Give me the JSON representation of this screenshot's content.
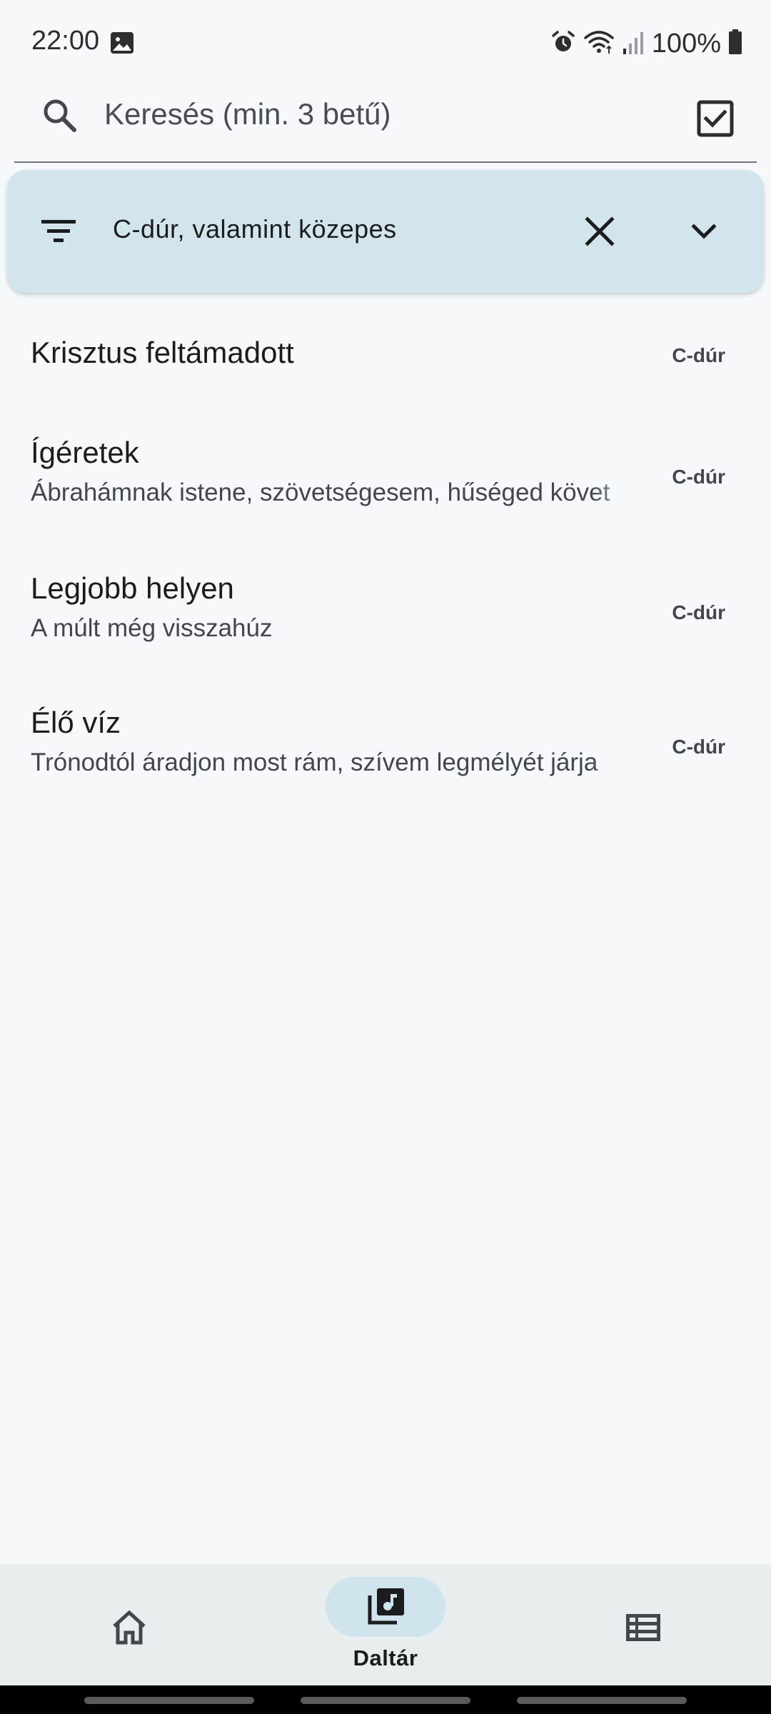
{
  "status_bar": {
    "time": "22:00",
    "battery": "100%",
    "icons": [
      "gallery-icon",
      "alarm-icon",
      "wifi-icon",
      "signal-icon",
      "battery-icon"
    ]
  },
  "search": {
    "placeholder": "Keresés (min. 3 betű)",
    "value": "",
    "icons": {
      "search": "search-icon",
      "select": "checkbox-icon"
    }
  },
  "filter": {
    "label": "C-dúr, valamint közepes",
    "icons": {
      "filter": "filter-icon",
      "clear": "close-icon",
      "expand": "chevron-down-icon"
    }
  },
  "songs": [
    {
      "title": "Krisztus feltámadott",
      "subtitle": "",
      "key": "C-dúr"
    },
    {
      "title": "Ígéretek",
      "subtitle": "Ábrahámnak istene, szövetségesem, hűséged követ",
      "key": "C-dúr"
    },
    {
      "title": "Legjobb helyen",
      "subtitle": "A múlt még visszahúz",
      "key": "C-dúr"
    },
    {
      "title": "Élő víz",
      "subtitle": "Trónodtól áradjon most rám, szívem legmélyét járja",
      "key": "C-dúr"
    }
  ],
  "bottom_nav": {
    "items": [
      {
        "icon": "home-icon",
        "label": "",
        "selected": false
      },
      {
        "icon": "music-library-icon",
        "label": "Daltár",
        "selected": true
      },
      {
        "icon": "list-icon",
        "label": "",
        "selected": false
      }
    ]
  },
  "colors": {
    "background": "#f5f9fc",
    "filter_card": "#d3e5ec",
    "nav_background": "#e8edf0",
    "nav_indicator": "#cfe4ec"
  }
}
